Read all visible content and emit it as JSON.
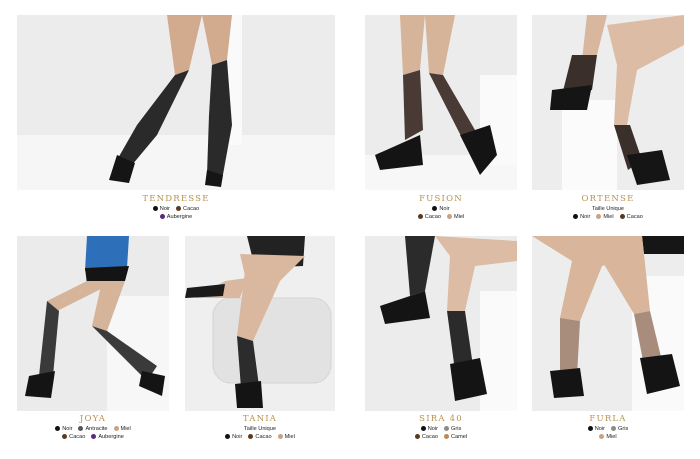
{
  "products": [
    {
      "name": "TENDRESSE",
      "lines": [
        [
          {
            "label": "Noir",
            "swatch": "#111111"
          },
          {
            "label": "Cacao",
            "swatch": "#5a3a1e"
          }
        ],
        [
          {
            "label": "Aubergine",
            "swatch": "#5b2a7c"
          }
        ]
      ]
    },
    {
      "name": "FUSION",
      "lines": [
        [
          {
            "label": "Noir",
            "swatch": "#111111"
          }
        ],
        [
          {
            "label": "Cacao",
            "swatch": "#5a3a1e"
          },
          {
            "label": "Miel",
            "swatch": "#c9a283"
          }
        ]
      ]
    },
    {
      "name": "ORTENSE",
      "lines": [
        [
          {
            "label": "Taille Unique"
          }
        ],
        [
          {
            "label": "Noir",
            "swatch": "#111111"
          },
          {
            "label": "Miel",
            "swatch": "#c9a283"
          },
          {
            "label": "Cacao",
            "swatch": "#5a3a1e"
          }
        ]
      ]
    },
    {
      "name": "JOYA",
      "lines": [
        [
          {
            "label": "Noir",
            "swatch": "#111111"
          },
          {
            "label": "Antracite",
            "swatch": "#555555"
          },
          {
            "label": "Miel",
            "swatch": "#c9a283"
          }
        ],
        [
          {
            "label": "Cacao",
            "swatch": "#5a3a1e"
          },
          {
            "label": "Aubergine",
            "swatch": "#5b2a7c"
          }
        ]
      ]
    },
    {
      "name": "TANIA",
      "lines": [
        [
          {
            "label": "Taille Unique"
          }
        ],
        [
          {
            "label": "Noir",
            "swatch": "#111111"
          },
          {
            "label": "Cacao",
            "swatch": "#5a3a1e"
          },
          {
            "label": "Miel",
            "swatch": "#c9a283"
          }
        ]
      ]
    },
    {
      "name": "SIRA 40",
      "lines": [
        [
          {
            "label": "Noir",
            "swatch": "#111111"
          },
          {
            "label": "Gris",
            "swatch": "#8a8a8a"
          }
        ],
        [
          {
            "label": "Cacao",
            "swatch": "#5a3a1e"
          },
          {
            "label": "Camel",
            "swatch": "#b98a55"
          }
        ]
      ]
    },
    {
      "name": "FURLA",
      "lines": [
        [
          {
            "label": "Noir",
            "swatch": "#111111"
          },
          {
            "label": "Gris",
            "swatch": "#8a8a8a"
          }
        ],
        [
          {
            "label": "Miel",
            "swatch": "#c9a283"
          }
        ]
      ]
    }
  ]
}
